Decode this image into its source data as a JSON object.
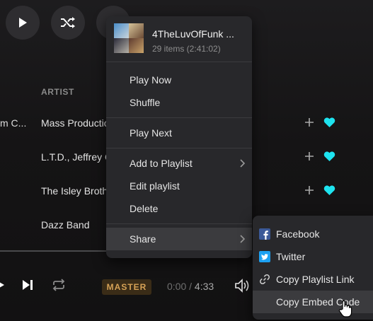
{
  "toolbar": {
    "play_icon": "play-icon",
    "shuffle_icon": "shuffle-icon",
    "more_icon": "more-icon"
  },
  "table": {
    "column_header": "ARTIST",
    "rows": [
      {
        "prev_col": "m C...",
        "artist": "Mass Productio"
      },
      {
        "prev_col": "",
        "artist": "L.T.D., Jeffrey O"
      },
      {
        "prev_col": "",
        "artist": "The Isley Brothe"
      },
      {
        "prev_col": "",
        "artist": "Dazz Band"
      }
    ],
    "add_icon": "plus-icon",
    "favorite_icon": "heart-icon",
    "favorite_color": "#1ee3ef"
  },
  "context_menu": {
    "title": "4TheLuvOfFunk ...",
    "subtitle": "29 items (2:41:02)",
    "items": {
      "play_now": "Play Now",
      "shuffle": "Shuffle",
      "play_next": "Play Next",
      "add_to_playlist": "Add to Playlist",
      "edit_playlist": "Edit playlist",
      "delete": "Delete",
      "share": "Share"
    }
  },
  "share_menu": {
    "items": [
      {
        "label": "Facebook",
        "icon": "facebook-icon",
        "color": "#3b5998"
      },
      {
        "label": "Twitter",
        "icon": "twitter-icon",
        "color": "#1da1f2"
      },
      {
        "label": "Copy Playlist Link",
        "icon": "link-icon"
      },
      {
        "label": "Copy Embed Code",
        "icon": "code-icon"
      }
    ]
  },
  "player": {
    "quality_badge": "MASTER",
    "quality_color": "#d6a256",
    "time_current": "0:00",
    "time_separator": " / ",
    "time_total": "4:33"
  }
}
